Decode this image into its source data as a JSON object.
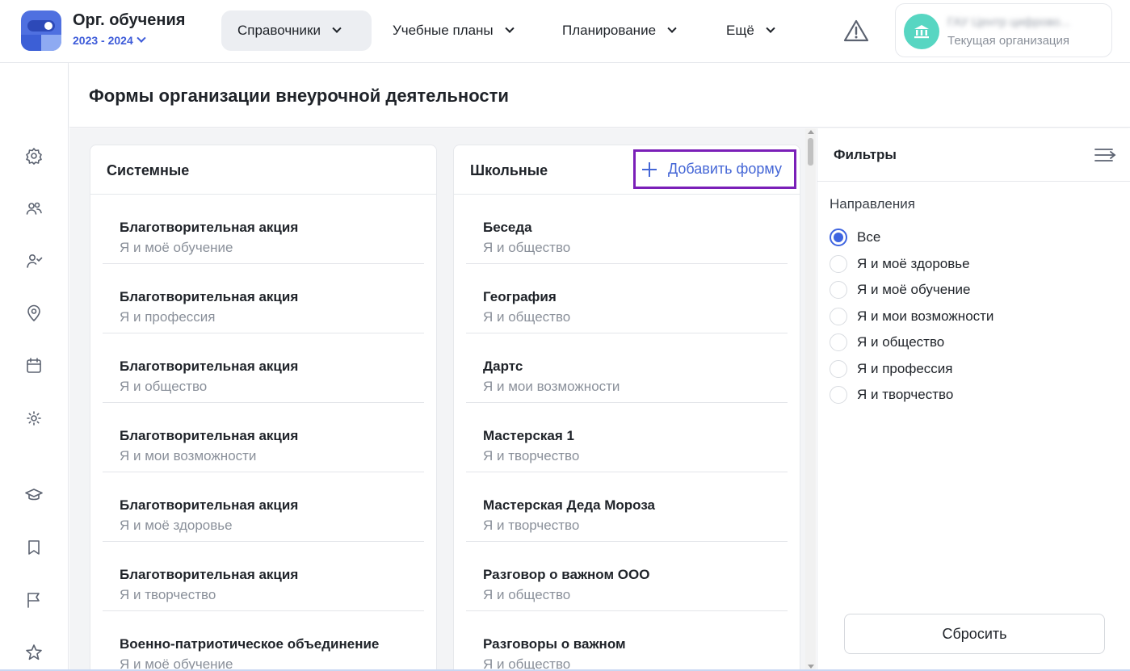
{
  "header": {
    "org_title": "Орг. обучения",
    "year": "2023 - 2024",
    "nav": [
      {
        "label": "Справочники"
      },
      {
        "label": "Учебные планы"
      },
      {
        "label": "Планирование"
      },
      {
        "label": "Ещё"
      }
    ],
    "org_name": "ГАУ Центр цифрово...",
    "org_sub": "Текущая организация"
  },
  "sidebar": {
    "icons": [
      "gear-icon",
      "users-icon",
      "user-check-icon",
      "location-pin-icon",
      "calendar-icon",
      "sun-icon",
      "graduation-cap-icon",
      "bookmark-icon",
      "flag-icon",
      "star-icon"
    ]
  },
  "page": {
    "title": "Формы организации внеурочной деятельности"
  },
  "system_column": {
    "title": "Системные",
    "items": [
      {
        "title": "Благотворительная акция",
        "sub": "Я и моё обучение"
      },
      {
        "title": "Благотворительная акция",
        "sub": "Я и профессия"
      },
      {
        "title": "Благотворительная акция",
        "sub": "Я и общество"
      },
      {
        "title": "Благотворительная акция",
        "sub": "Я и мои возможности"
      },
      {
        "title": "Благотворительная акция",
        "sub": "Я и моё здоровье"
      },
      {
        "title": "Благотворительная акция",
        "sub": "Я и творчество"
      },
      {
        "title": "Военно-патриотическое объединение",
        "sub": "Я и моё обучение"
      }
    ]
  },
  "school_column": {
    "title": "Школьные",
    "add_label": "Добавить форму",
    "items": [
      {
        "title": "Беседа",
        "sub": "Я и общество"
      },
      {
        "title": "География",
        "sub": "Я и общество"
      },
      {
        "title": "Дартс",
        "sub": "Я и мои возможности"
      },
      {
        "title": "Мастерская 1",
        "sub": "Я и творчество"
      },
      {
        "title": "Мастерская Деда Мороза",
        "sub": "Я и творчество"
      },
      {
        "title": "Разговор о важном ООО",
        "sub": "Я и общество"
      },
      {
        "title": "Разговоры о важном",
        "sub": "Я и общество"
      }
    ]
  },
  "filters": {
    "title": "Фильтры",
    "section": "Направления",
    "options": [
      {
        "label": "Все",
        "checked": true
      },
      {
        "label": "Я и моё здоровье",
        "checked": false
      },
      {
        "label": "Я и моё обучение",
        "checked": false
      },
      {
        "label": "Я и мои возможности",
        "checked": false
      },
      {
        "label": "Я и общество",
        "checked": false
      },
      {
        "label": "Я и профессия",
        "checked": false
      },
      {
        "label": "Я и творчество",
        "checked": false
      }
    ],
    "reset_label": "Сбросить"
  },
  "colors": {
    "accent": "#3e64e0",
    "highlight_border": "#7a1fb8",
    "avatar": "#57d6c2"
  }
}
